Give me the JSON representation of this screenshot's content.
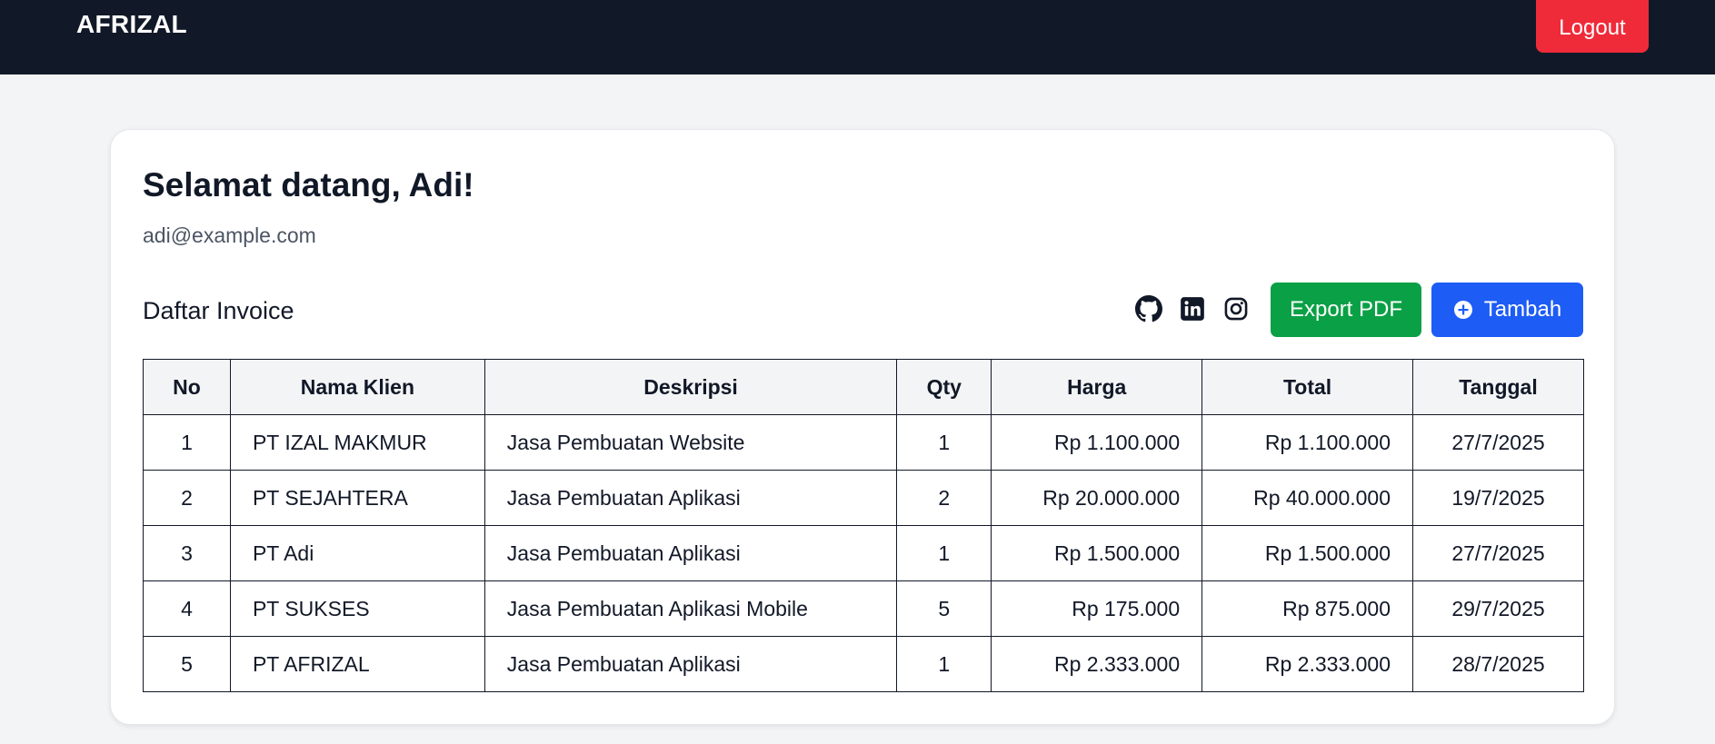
{
  "navbar": {
    "brand": "AFRIZAL",
    "logout_label": "Logout"
  },
  "user": {
    "greeting": "Selamat datang, Adi!",
    "email": "adi@example.com"
  },
  "invoice": {
    "title": "Daftar Invoice",
    "social_icons": [
      "github-icon",
      "linkedin-icon",
      "instagram-icon"
    ],
    "export_label": "Export PDF",
    "add_label": "Tambah",
    "add_icon": "plus-circle-icon",
    "columns": [
      "No",
      "Nama Klien",
      "Deskripsi",
      "Qty",
      "Harga",
      "Total",
      "Tanggal"
    ],
    "rows": [
      [
        "1",
        "PT IZAL MAKMUR",
        "Jasa Pembuatan Website",
        "1",
        "Rp 1.100.000",
        "Rp 1.100.000",
        "27/7/2025"
      ],
      [
        "2",
        "PT SEJAHTERA",
        "Jasa Pembuatan Aplikasi",
        "2",
        "Rp 20.000.000",
        "Rp 40.000.000",
        "19/7/2025"
      ],
      [
        "3",
        "PT Adi",
        "Jasa Pembuatan Aplikasi",
        "1",
        "Rp 1.500.000",
        "Rp 1.500.000",
        "27/7/2025"
      ],
      [
        "4",
        "PT SUKSES",
        "Jasa Pembuatan Aplikasi Mobile",
        "5",
        "Rp 175.000",
        "Rp 875.000",
        "29/7/2025"
      ],
      [
        "5",
        "PT AFRIZAL",
        "Jasa Pembuatan Aplikasi",
        "1",
        "Rp 2.333.000",
        "Rp 2.333.000",
        "28/7/2025"
      ]
    ]
  },
  "colors": {
    "navbar_bg": "#111827",
    "logout_bg": "#ef2b3a",
    "export_bg": "#0aa045",
    "add_bg": "#1d5cf5",
    "page_bg": "#f3f4f6"
  }
}
